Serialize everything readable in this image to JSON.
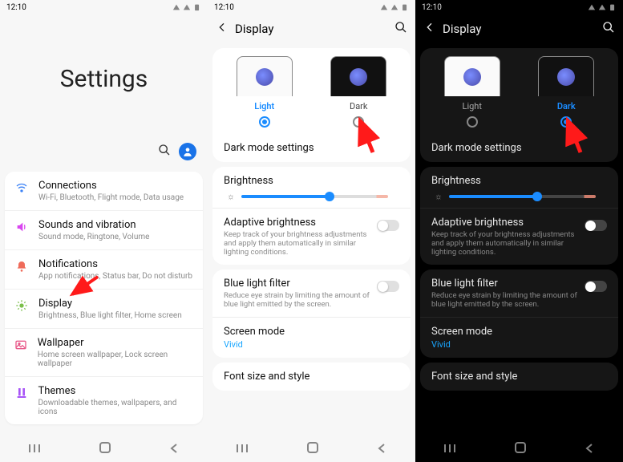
{
  "status": {
    "time": "12:10"
  },
  "panel1": {
    "title": "Settings",
    "items": [
      {
        "icon": "wifi",
        "color": "#3b82f6",
        "title": "Connections",
        "sub": "Wi-Fi, Bluetooth, Flight mode, Data usage"
      },
      {
        "icon": "speaker",
        "color": "#d946ef",
        "title": "Sounds and vibration",
        "sub": "Sound mode, Ringtone, Volume"
      },
      {
        "icon": "bell",
        "color": "#ef6b5a",
        "title": "Notifications",
        "sub": "App notifications, Status bar, Do not disturb"
      },
      {
        "icon": "sun",
        "color": "#7bbf4b",
        "title": "Display",
        "sub": "Brightness, Blue light filter, Home screen"
      },
      {
        "icon": "image",
        "color": "#e85a8a",
        "title": "Wallpaper",
        "sub": "Home screen wallpaper, Lock screen wallpaper"
      },
      {
        "icon": "palette",
        "color": "#a855f7",
        "title": "Themes",
        "sub": "Downloadable themes, wallpapers, and icons"
      }
    ]
  },
  "display": {
    "page_title": "Display",
    "modes": {
      "light": "Light",
      "dark": "Dark"
    },
    "dark_mode_settings": "Dark mode settings",
    "brightness": {
      "label": "Brightness",
      "value_pct": 60
    },
    "adaptive": {
      "title": "Adaptive brightness",
      "desc": "Keep track of your brightness adjustments and apply them automatically in similar lighting conditions.",
      "on": false
    },
    "bluelight": {
      "title": "Blue light filter",
      "desc": "Reduce eye strain by limiting the amount of blue light emitted by the screen.",
      "on": false
    },
    "screenmode": {
      "title": "Screen mode",
      "value": "Vivid"
    },
    "fontsize": "Font size and style"
  }
}
